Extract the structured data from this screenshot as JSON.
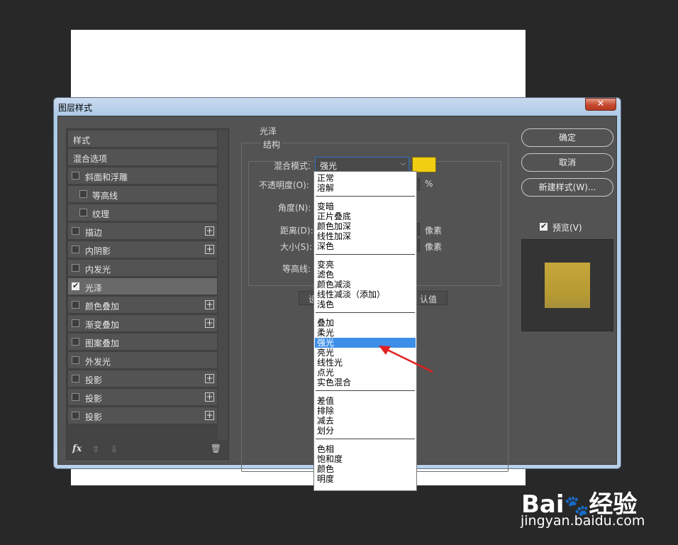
{
  "dialog": {
    "title": "图层样式",
    "close": "✕"
  },
  "styles_list": {
    "items": [
      {
        "label": "样式",
        "checkbox": false,
        "checked": false,
        "indent": false,
        "plus": false,
        "selected": false
      },
      {
        "label": "混合选项",
        "checkbox": false,
        "checked": false,
        "indent": false,
        "plus": false,
        "selected": false
      },
      {
        "label": "斜面和浮雕",
        "checkbox": true,
        "checked": false,
        "indent": false,
        "plus": false,
        "selected": false
      },
      {
        "label": "等高线",
        "checkbox": true,
        "checked": false,
        "indent": true,
        "plus": false,
        "selected": false
      },
      {
        "label": "纹理",
        "checkbox": true,
        "checked": false,
        "indent": true,
        "plus": false,
        "selected": false
      },
      {
        "label": "描边",
        "checkbox": true,
        "checked": false,
        "indent": false,
        "plus": true,
        "selected": false
      },
      {
        "label": "内阴影",
        "checkbox": true,
        "checked": false,
        "indent": false,
        "plus": true,
        "selected": false
      },
      {
        "label": "内发光",
        "checkbox": true,
        "checked": false,
        "indent": false,
        "plus": false,
        "selected": false
      },
      {
        "label": "光泽",
        "checkbox": true,
        "checked": true,
        "indent": false,
        "plus": false,
        "selected": true
      },
      {
        "label": "颜色叠加",
        "checkbox": true,
        "checked": false,
        "indent": false,
        "plus": true,
        "selected": false
      },
      {
        "label": "渐变叠加",
        "checkbox": true,
        "checked": false,
        "indent": false,
        "plus": true,
        "selected": false
      },
      {
        "label": "图案叠加",
        "checkbox": true,
        "checked": false,
        "indent": false,
        "plus": false,
        "selected": false
      },
      {
        "label": "外发光",
        "checkbox": true,
        "checked": false,
        "indent": false,
        "plus": false,
        "selected": false
      },
      {
        "label": "投影",
        "checkbox": true,
        "checked": false,
        "indent": false,
        "plus": true,
        "selected": false
      },
      {
        "label": "投影",
        "checkbox": true,
        "checked": false,
        "indent": false,
        "plus": true,
        "selected": false
      },
      {
        "label": "投影",
        "checkbox": true,
        "checked": false,
        "indent": false,
        "plus": true,
        "selected": false
      }
    ],
    "footer": {
      "fx": "fx",
      "up": "⇧",
      "down": "⇩",
      "trash": "🗑"
    }
  },
  "satin": {
    "group_title": "光泽",
    "structure_title": "结构",
    "blend_mode_label": "混合模式:",
    "blend_mode_value": "强光",
    "color_swatch": "#f1ce12",
    "opacity_label": "不透明度(O):",
    "opacity_unit": "%",
    "angle_label": "角度(N):",
    "distance_label": "距离(D):",
    "distance_unit": "像素",
    "size_label": "大小(S):",
    "size_unit": "像素",
    "contour_label": "等高线:",
    "set_default_partial": "设",
    "reset_default_partial": "认值"
  },
  "buttons": {
    "ok": "确定",
    "cancel": "取消",
    "new_style": "新建样式(W)...",
    "preview": "预览(V)"
  },
  "blend_dropdown": {
    "highlighted": "强光",
    "groups": [
      [
        "正常",
        "溶解"
      ],
      [
        "变暗",
        "正片叠底",
        "颜色加深",
        "线性加深",
        "深色"
      ],
      [
        "变亮",
        "滤色",
        "颜色减淡",
        "线性减淡（添加）",
        "浅色"
      ],
      [
        "叠加",
        "柔光",
        "强光",
        "亮光",
        "线性光",
        "点光",
        "实色混合"
      ],
      [
        "差值",
        "排除",
        "减去",
        "划分"
      ],
      [
        "色相",
        "饱和度",
        "颜色",
        "明度"
      ]
    ]
  },
  "colors": {
    "accent": "#3d8ee8",
    "annotation_arrow": "#e02020"
  },
  "watermark": {
    "main": "Bai",
    "paw": "🐾",
    "brand": "经验",
    "sub": "jingyan.baidu.com"
  }
}
